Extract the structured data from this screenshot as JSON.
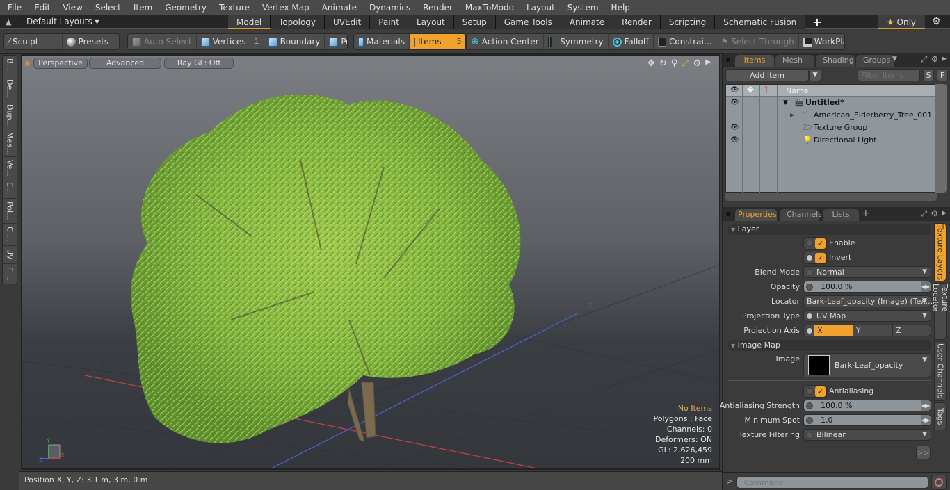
{
  "menubar": [
    "File",
    "Edit",
    "View",
    "Select",
    "Item",
    "Geometry",
    "Texture",
    "Vertex Map",
    "Animate",
    "Dynamics",
    "Render",
    "MaxToModo",
    "Layout",
    "System",
    "Help"
  ],
  "layoutbar": {
    "layouts_label": "Default Layouts",
    "tabs": [
      "Model",
      "Topology",
      "UVEdit",
      "Paint",
      "Layout",
      "Setup",
      "Game Tools",
      "Animate",
      "Render",
      "Scripting",
      "Schematic Fusion"
    ],
    "active_tab": "Model",
    "only_label": "Only"
  },
  "toolbar": {
    "sculpt": "Sculpt",
    "presets": "Presets",
    "auto_select": "Auto Select",
    "vertices": "Vertices",
    "vertices_count": "1",
    "boundary": "Boundary",
    "polygons": "Polygons",
    "materials": "Materials",
    "items": "Items",
    "items_count": "5",
    "action_center": "Action Center",
    "symmetry": "Symmetry",
    "falloff": "Falloff",
    "constraints": "Constrai...",
    "select_through": "Select Through",
    "workplane": "WorkPlane"
  },
  "left_tabs": [
    "B...",
    "De...",
    "Dup...",
    "Mes...",
    "Ve...",
    "E...",
    "Pol...",
    "C ...",
    "UV",
    "F ..."
  ],
  "viewport": {
    "view_mode": "Perspective",
    "shading": "Advanced",
    "ray_gl": "Ray GL: Off",
    "info": {
      "selection": "No Items",
      "polygons": "Polygons : Face",
      "channels": "Channels: 0",
      "deformers": "Deformers: ON",
      "gl": "GL: 2,626,459",
      "grid": "200 mm"
    },
    "axis_labels": {
      "x": "X",
      "neg_x": "-X",
      "neg_z": "-Z",
      "y": "Y",
      "z": "Z"
    }
  },
  "statusbar": {
    "position": "Position X, Y, Z:   3.1 m, 3 m, 0 m"
  },
  "items_panel": {
    "tabs": [
      "Items",
      "Mesh ...",
      "Shading",
      "Groups"
    ],
    "active_tab": "Items",
    "add_item": "Add Item",
    "filter_placeholder": "Filter Items",
    "s_btn": "S",
    "f_btn": "F",
    "col_name": "Name",
    "tree": [
      {
        "name": "Untitled*",
        "level": 0,
        "visible": true,
        "bold": true
      },
      {
        "name": "American_Elderberry_Tree_001",
        "level": 1,
        "visible": false,
        "bold": false
      },
      {
        "name": "Texture Group",
        "level": 1,
        "visible": true,
        "bold": false
      },
      {
        "name": "Directional Light",
        "level": 1,
        "visible": true,
        "bold": false
      }
    ]
  },
  "properties_panel": {
    "tabs": [
      "Properties",
      "Channels",
      "Lists"
    ],
    "active_tab": "Properties",
    "layer_section": "Layer",
    "enable_label": "Enable",
    "enable": true,
    "invert_label": "Invert",
    "invert": true,
    "blend_mode_label": "Blend Mode",
    "blend_mode": "Normal",
    "opacity_label": "Opacity",
    "opacity": "100.0 %",
    "locator_label": "Locator",
    "locator": "Bark-Leaf_opacity (Image) (Tex...",
    "projection_type_label": "Projection Type",
    "projection_type": "UV Map",
    "projection_axis_label": "Projection Axis",
    "projection_axes": [
      "X",
      "Y",
      "Z"
    ],
    "projection_axis": "X",
    "image_map_section": "Image Map",
    "image_label": "Image",
    "image": "Bark-Leaf_opacity",
    "antialiasing_label": "Antialiasing",
    "antialiasing": true,
    "aa_strength_label": "Antialiasing Strength",
    "aa_strength": "100.0 %",
    "min_spot_label": "Minimum Spot",
    "min_spot": "1.0",
    "tex_filter_label": "Texture Filtering",
    "tex_filter": "Bilinear",
    "more_btn": ">>",
    "side_tabs": [
      "Texture Layers",
      "Texture Locator",
      "User Channels",
      "Tags"
    ],
    "active_side_tab": "Texture Layers"
  },
  "command": {
    "placeholder": "Command",
    "prompt": ">"
  },
  "colors": {
    "accent": "#f0a22d",
    "info_highlight": "#e8b54a"
  }
}
